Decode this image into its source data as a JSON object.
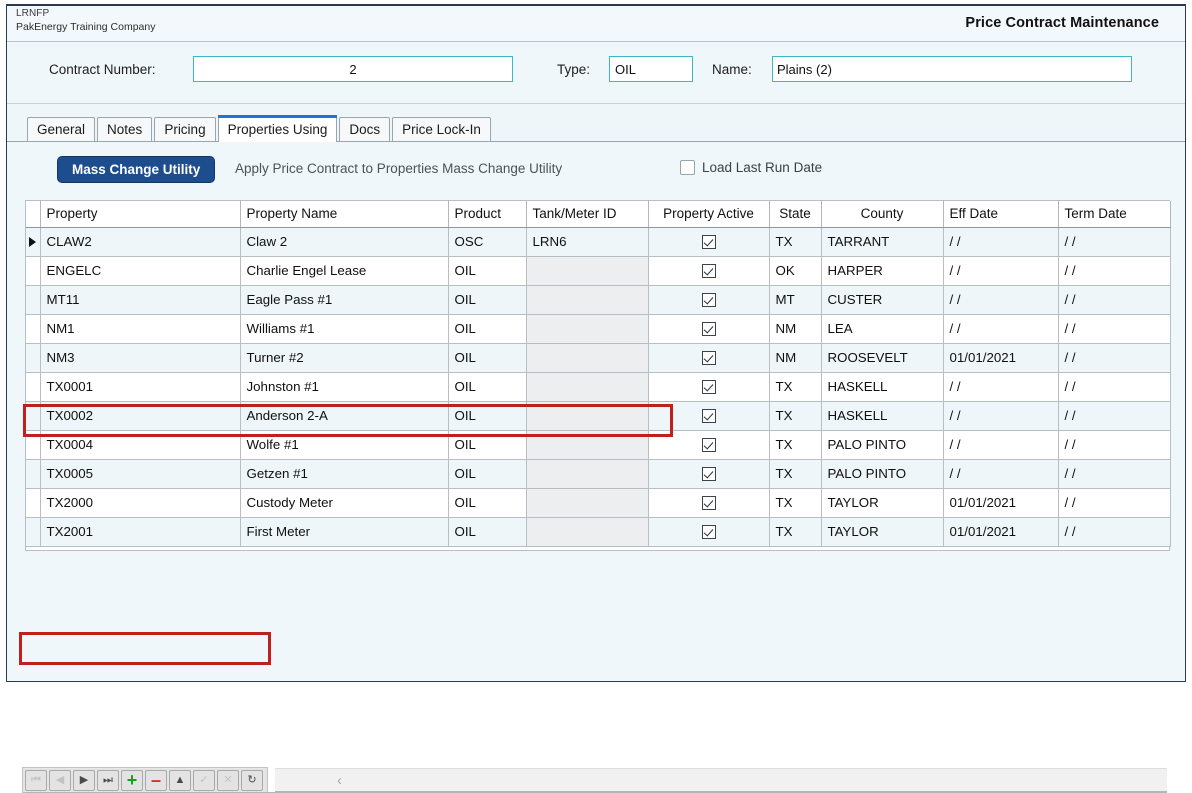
{
  "window": {
    "company_code": "LRNFP",
    "company_name": "PakEnergy Training Company",
    "screen_title": "Price Contract Maintenance"
  },
  "header_form": {
    "contract_number_label": "Contract Number:",
    "contract_number_value": "2",
    "type_label": "Type:",
    "type_value": "OIL",
    "name_label": "Name:",
    "name_value": "Plains (2)"
  },
  "tabs": [
    {
      "label": "General",
      "active": false
    },
    {
      "label": "Notes",
      "active": false
    },
    {
      "label": "Pricing",
      "active": false
    },
    {
      "label": "Properties Using",
      "active": true
    },
    {
      "label": "Docs",
      "active": false
    },
    {
      "label": "Price Lock-In",
      "active": false
    }
  ],
  "toolbar": {
    "mass_change_button": "Mass Change Utility",
    "mass_change_description": "Apply Price Contract to Properties Mass Change Utility",
    "load_last_run_label": "Load Last Run Date",
    "load_last_run_checked": false
  },
  "grid": {
    "columns": [
      "Property",
      "Property Name",
      "Product",
      "Tank/Meter ID",
      "Property Active",
      "State",
      "County",
      "Eff Date",
      "Term Date"
    ],
    "rows": [
      {
        "property": "CLAW2",
        "property_name": "Claw 2",
        "product": "OSC",
        "tank_meter_id": "LRN6",
        "property_active": true,
        "state": "TX",
        "county": "TARRANT",
        "eff_date": "/ /",
        "term_date": "/ /",
        "selected": true
      },
      {
        "property": "ENGELC",
        "property_name": "Charlie Engel Lease",
        "product": "OIL",
        "tank_meter_id": "",
        "property_active": true,
        "state": "OK",
        "county": "HARPER",
        "eff_date": "/ /",
        "term_date": "/ /",
        "selected": false
      },
      {
        "property": "MT11",
        "property_name": "Eagle Pass #1",
        "product": "OIL",
        "tank_meter_id": "",
        "property_active": true,
        "state": "MT",
        "county": "CUSTER",
        "eff_date": "/ /",
        "term_date": "/ /",
        "selected": false
      },
      {
        "property": "NM1",
        "property_name": "Williams #1",
        "product": "OIL",
        "tank_meter_id": "",
        "property_active": true,
        "state": "NM",
        "county": "LEA",
        "eff_date": "/ /",
        "term_date": "/ /",
        "selected": false
      },
      {
        "property": "NM3",
        "property_name": "Turner #2",
        "product": "OIL",
        "tank_meter_id": "",
        "property_active": true,
        "state": "NM",
        "county": "ROOSEVELT",
        "eff_date": "01/01/2021",
        "term_date": "/ /",
        "selected": false
      },
      {
        "property": "TX0001",
        "property_name": "Johnston #1",
        "product": "OIL",
        "tank_meter_id": "",
        "property_active": true,
        "state": "TX",
        "county": "HASKELL",
        "eff_date": "/ /",
        "term_date": "/ /",
        "selected": false
      },
      {
        "property": "TX0002",
        "property_name": "Anderson 2-A",
        "product": "OIL",
        "tank_meter_id": "",
        "property_active": true,
        "state": "TX",
        "county": "HASKELL",
        "eff_date": "/ /",
        "term_date": "/ /",
        "selected": false
      },
      {
        "property": "TX0004",
        "property_name": "Wolfe #1",
        "product": "OIL",
        "tank_meter_id": "",
        "property_active": true,
        "state": "TX",
        "county": "PALO PINTO",
        "eff_date": "/ /",
        "term_date": "/ /",
        "selected": false
      },
      {
        "property": "TX0005",
        "property_name": "Getzen #1",
        "product": "OIL",
        "tank_meter_id": "",
        "property_active": true,
        "state": "TX",
        "county": "PALO PINTO",
        "eff_date": "/ /",
        "term_date": "/ /",
        "selected": false
      },
      {
        "property": "TX2000",
        "property_name": "Custody Meter",
        "product": "OIL",
        "tank_meter_id": "",
        "property_active": true,
        "state": "TX",
        "county": "TAYLOR",
        "eff_date": "01/01/2021",
        "term_date": "/ /",
        "selected": false
      },
      {
        "property": "TX2001",
        "property_name": "First Meter",
        "product": "OIL",
        "tank_meter_id": "",
        "property_active": true,
        "state": "TX",
        "county": "TAYLOR",
        "eff_date": "01/01/2021",
        "term_date": "/ /",
        "selected": false
      }
    ]
  },
  "navbar": {
    "buttons": [
      {
        "name": "first-record-button",
        "glyph": "⏮",
        "enabled": false
      },
      {
        "name": "previous-record-button",
        "glyph": "◀",
        "enabled": false
      },
      {
        "name": "next-record-button",
        "glyph": "▶",
        "enabled": true
      },
      {
        "name": "last-record-button",
        "glyph": "⏭",
        "enabled": true
      },
      {
        "name": "add-record-button",
        "glyph": "+",
        "enabled": true
      },
      {
        "name": "delete-record-button",
        "glyph": "–",
        "enabled": true
      },
      {
        "name": "edit-record-button",
        "glyph": "▲",
        "enabled": true
      },
      {
        "name": "post-edit-button",
        "glyph": "✓",
        "enabled": false
      },
      {
        "name": "cancel-edit-button",
        "glyph": "✕",
        "enabled": false
      },
      {
        "name": "refresh-button",
        "glyph": "↻",
        "enabled": true
      }
    ],
    "status_chevron": "‹"
  },
  "colors": {
    "accent_teal": "#3cb8c4",
    "tab_active_bar": "#1b77d1",
    "primary_button": "#1d4d8c",
    "highlight_red": "#c0201c",
    "row_alt": "#eef6fa"
  }
}
